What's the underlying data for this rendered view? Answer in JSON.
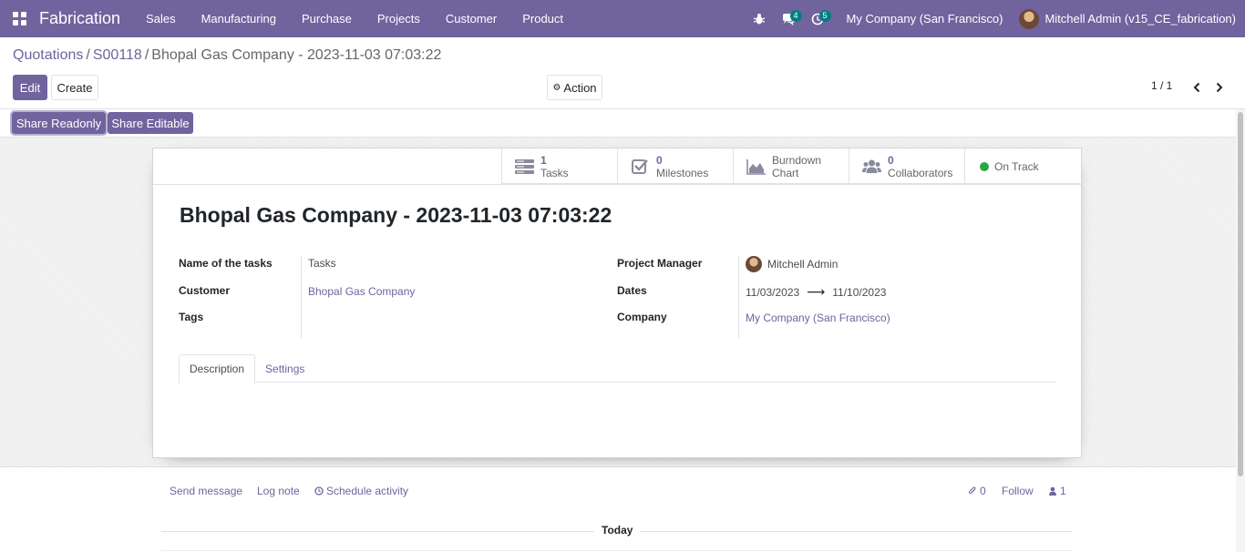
{
  "navbar": {
    "app_name": "Fabrication",
    "menu": [
      "Sales",
      "Manufacturing",
      "Purchase",
      "Projects",
      "Customer",
      "Product"
    ],
    "messages_badge": "4",
    "activities_badge": "5",
    "company": "My Company (San Francisco)",
    "user": "Mitchell Admin (v15_CE_fabrication)",
    "accent_color": "#71639e"
  },
  "breadcrumb": {
    "level1": "Quotations",
    "level2": "S00118",
    "current": "Bhopal Gas Company - 2023-11-03 07:03:22",
    "separator": "/"
  },
  "toolbar": {
    "edit_label": "Edit",
    "create_label": "Create",
    "action_label": "Action",
    "pager_value": "1 / 1"
  },
  "statusbar": {
    "share_readonly_label": "Share Readonly",
    "share_editable_label": "Share Editable"
  },
  "smart_buttons": {
    "tasks": {
      "value": "1",
      "label": "Tasks",
      "icon": "tasks-icon"
    },
    "milestones": {
      "value": "0",
      "label": "Milestones",
      "icon": "check-square-icon"
    },
    "burndown": {
      "line1": "Burndown",
      "line2": "Chart",
      "icon": "area-chart-icon"
    },
    "collaborators": {
      "value": "0",
      "label": "Collaborators",
      "icon": "users-icon"
    },
    "status": {
      "label": "On Track",
      "color": "#28a745"
    }
  },
  "record": {
    "title": "Bhopal Gas Company - 2023-11-03 07:03:22",
    "fields": {
      "tasks_name_label": "Name of the tasks",
      "tasks_name_value": "Tasks",
      "customer_label": "Customer",
      "customer_value": "Bhopal Gas Company",
      "tags_label": "Tags",
      "project_manager_label": "Project Manager",
      "project_manager_value": "Mitchell Admin",
      "dates_label": "Dates",
      "date_start": "11/03/2023",
      "date_end": "11/10/2023",
      "date_arrow": "⟶",
      "company_label": "Company",
      "company_value": "My Company (San Francisco)"
    },
    "tabs": [
      "Description",
      "Settings"
    ],
    "active_tab": "Description"
  },
  "chatter": {
    "send_message": "Send message",
    "log_note": "Log note",
    "schedule_activity": "Schedule activity",
    "attachments_count": "0",
    "follow_label": "Follow",
    "followers_count": "1",
    "today_label": "Today"
  }
}
